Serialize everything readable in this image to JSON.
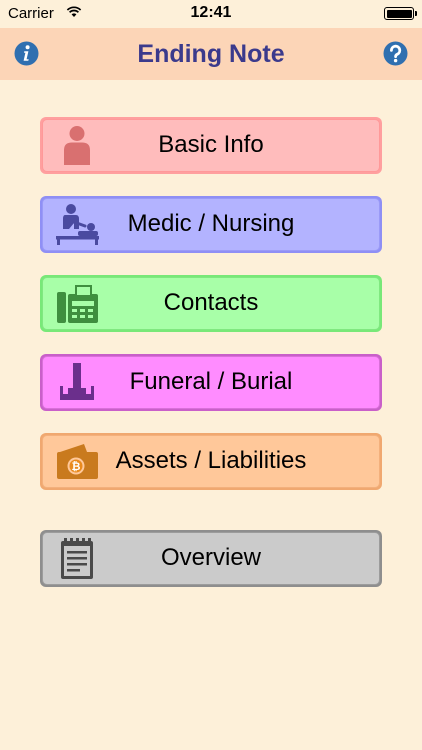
{
  "status_bar": {
    "carrier": "Carrier",
    "time": "12:41"
  },
  "nav": {
    "title": "Ending Note",
    "left_icon": "info-icon",
    "right_icon": "help-icon",
    "accent": "#3b3a8c"
  },
  "menu": {
    "basic_info": "Basic Info",
    "medic_nursing": "Medic / Nursing",
    "contacts": "Contacts",
    "funeral_burial": "Funeral / Burial",
    "assets_liabilities": "Assets / Liabilities",
    "overview": "Overview"
  },
  "colors": {
    "background": "#fdf0d9",
    "nav_background": "#fcd5b7",
    "basic_info": "#ffbcbc",
    "medic_nursing": "#b3b3ff",
    "contacts": "#a8ffa8",
    "funeral_burial": "#ff8cff",
    "assets_liabilities": "#ffc89a",
    "overview": "#cbcbcb"
  }
}
